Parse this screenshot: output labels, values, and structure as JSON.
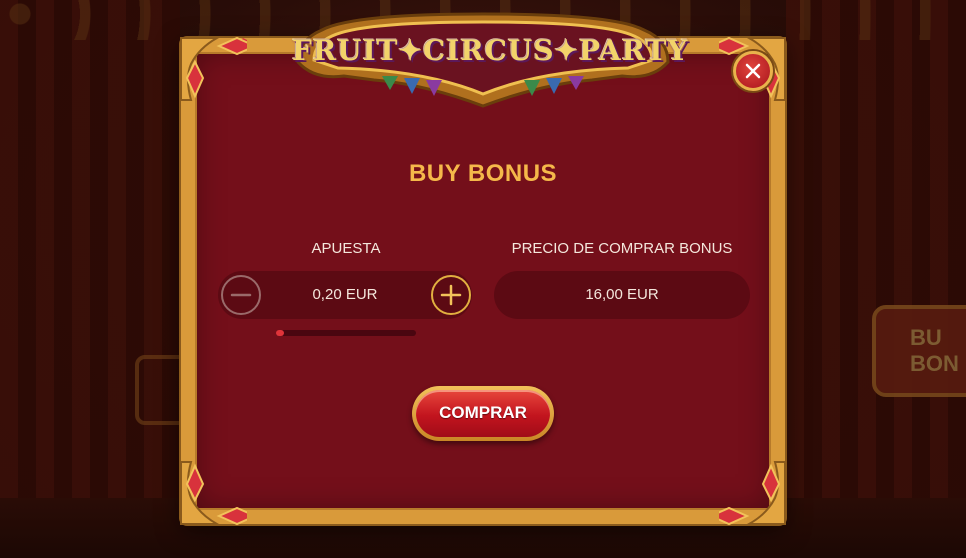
{
  "game": {
    "logo_text": "FRUIT✦CIRCUS✦PARTY"
  },
  "background": {
    "sign_text_line1": "BU",
    "sign_text_line2": "BON"
  },
  "dialog": {
    "title": "BUY BONUS",
    "bet": {
      "label": "APUESTA",
      "value": "0,20 EUR",
      "slider_level": 0.06
    },
    "price": {
      "label": "PRECIO DE COMPRAR BONUS",
      "value": "16,00 EUR"
    },
    "buy_button_label": "COMPRAR"
  },
  "icons": {
    "close": "close-icon",
    "minus": "minus-icon",
    "plus": "plus-icon"
  },
  "colors": {
    "panel": "#740f1a",
    "frame_gold": "#d99a3a",
    "title": "#f5b84a",
    "button_red": "#c2141e"
  }
}
